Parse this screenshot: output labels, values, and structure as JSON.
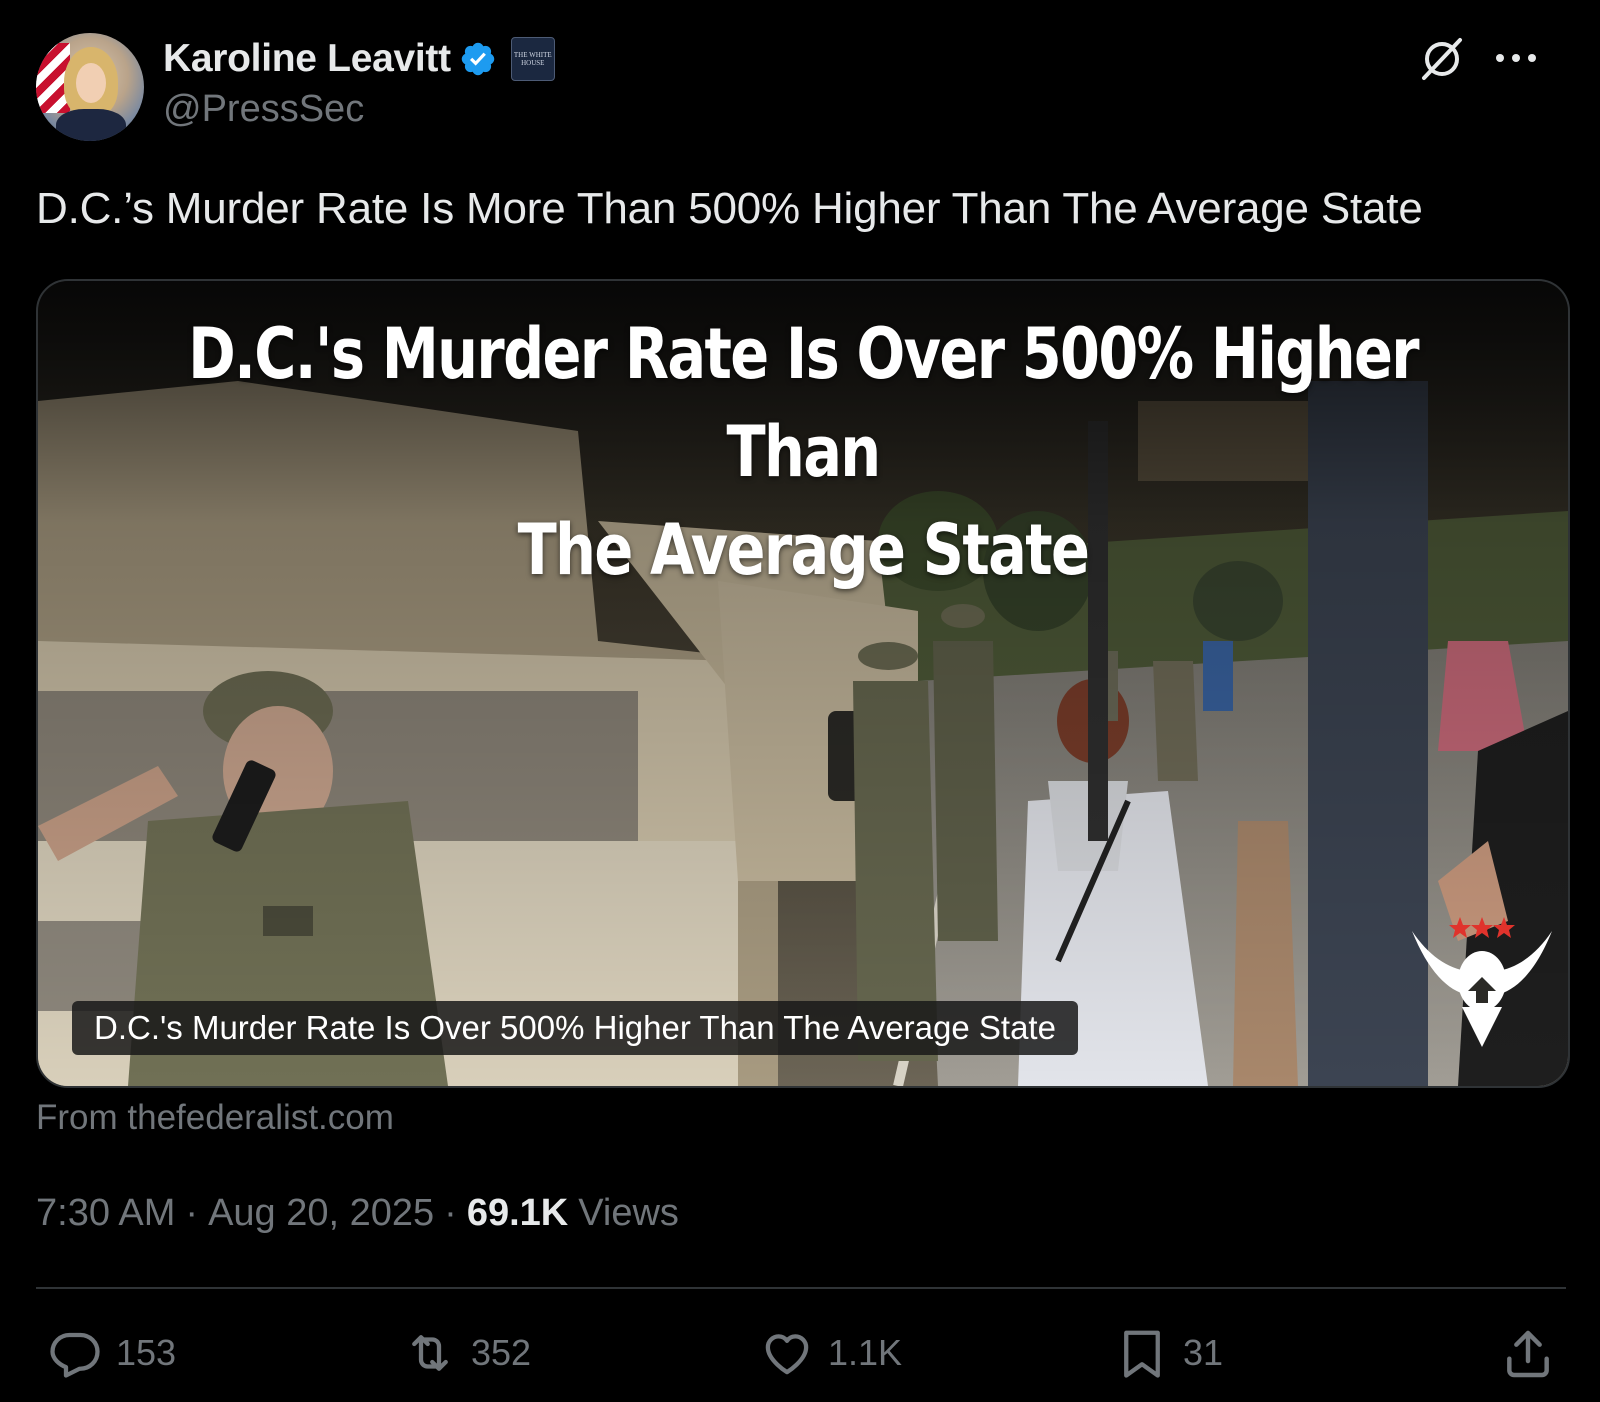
{
  "author": {
    "display_name": "Karoline Leavitt",
    "handle": "@PressSec",
    "verified_badge_color": "#1d9bf0",
    "affiliation_badge_text": "THE WHITE HOUSE"
  },
  "tweet": {
    "text": "D.C.’s Murder Rate Is More Than 500% Higher Than The Average State"
  },
  "card": {
    "headline_line1": "D.C.'s Murder Rate Is Over 500% Higher Than",
    "headline_line2": "The Average State",
    "caption": "D.C.'s Murder Rate Is Over 500% Higher Than The Average State",
    "source": "From thefederalist.com"
  },
  "meta": {
    "time": "7:30 AM",
    "date": "Aug 20, 2025",
    "separator": "·",
    "views_count": "69.1K",
    "views_label": "Views"
  },
  "actions": {
    "replies": "153",
    "reposts": "352",
    "likes": "1.1K",
    "bookmarks": "31"
  },
  "icons": [
    "verified-icon",
    "grok-icon",
    "more-icon",
    "reply-icon",
    "repost-icon",
    "like-icon",
    "bookmark-icon",
    "share-icon",
    "eagle-logo-icon"
  ]
}
